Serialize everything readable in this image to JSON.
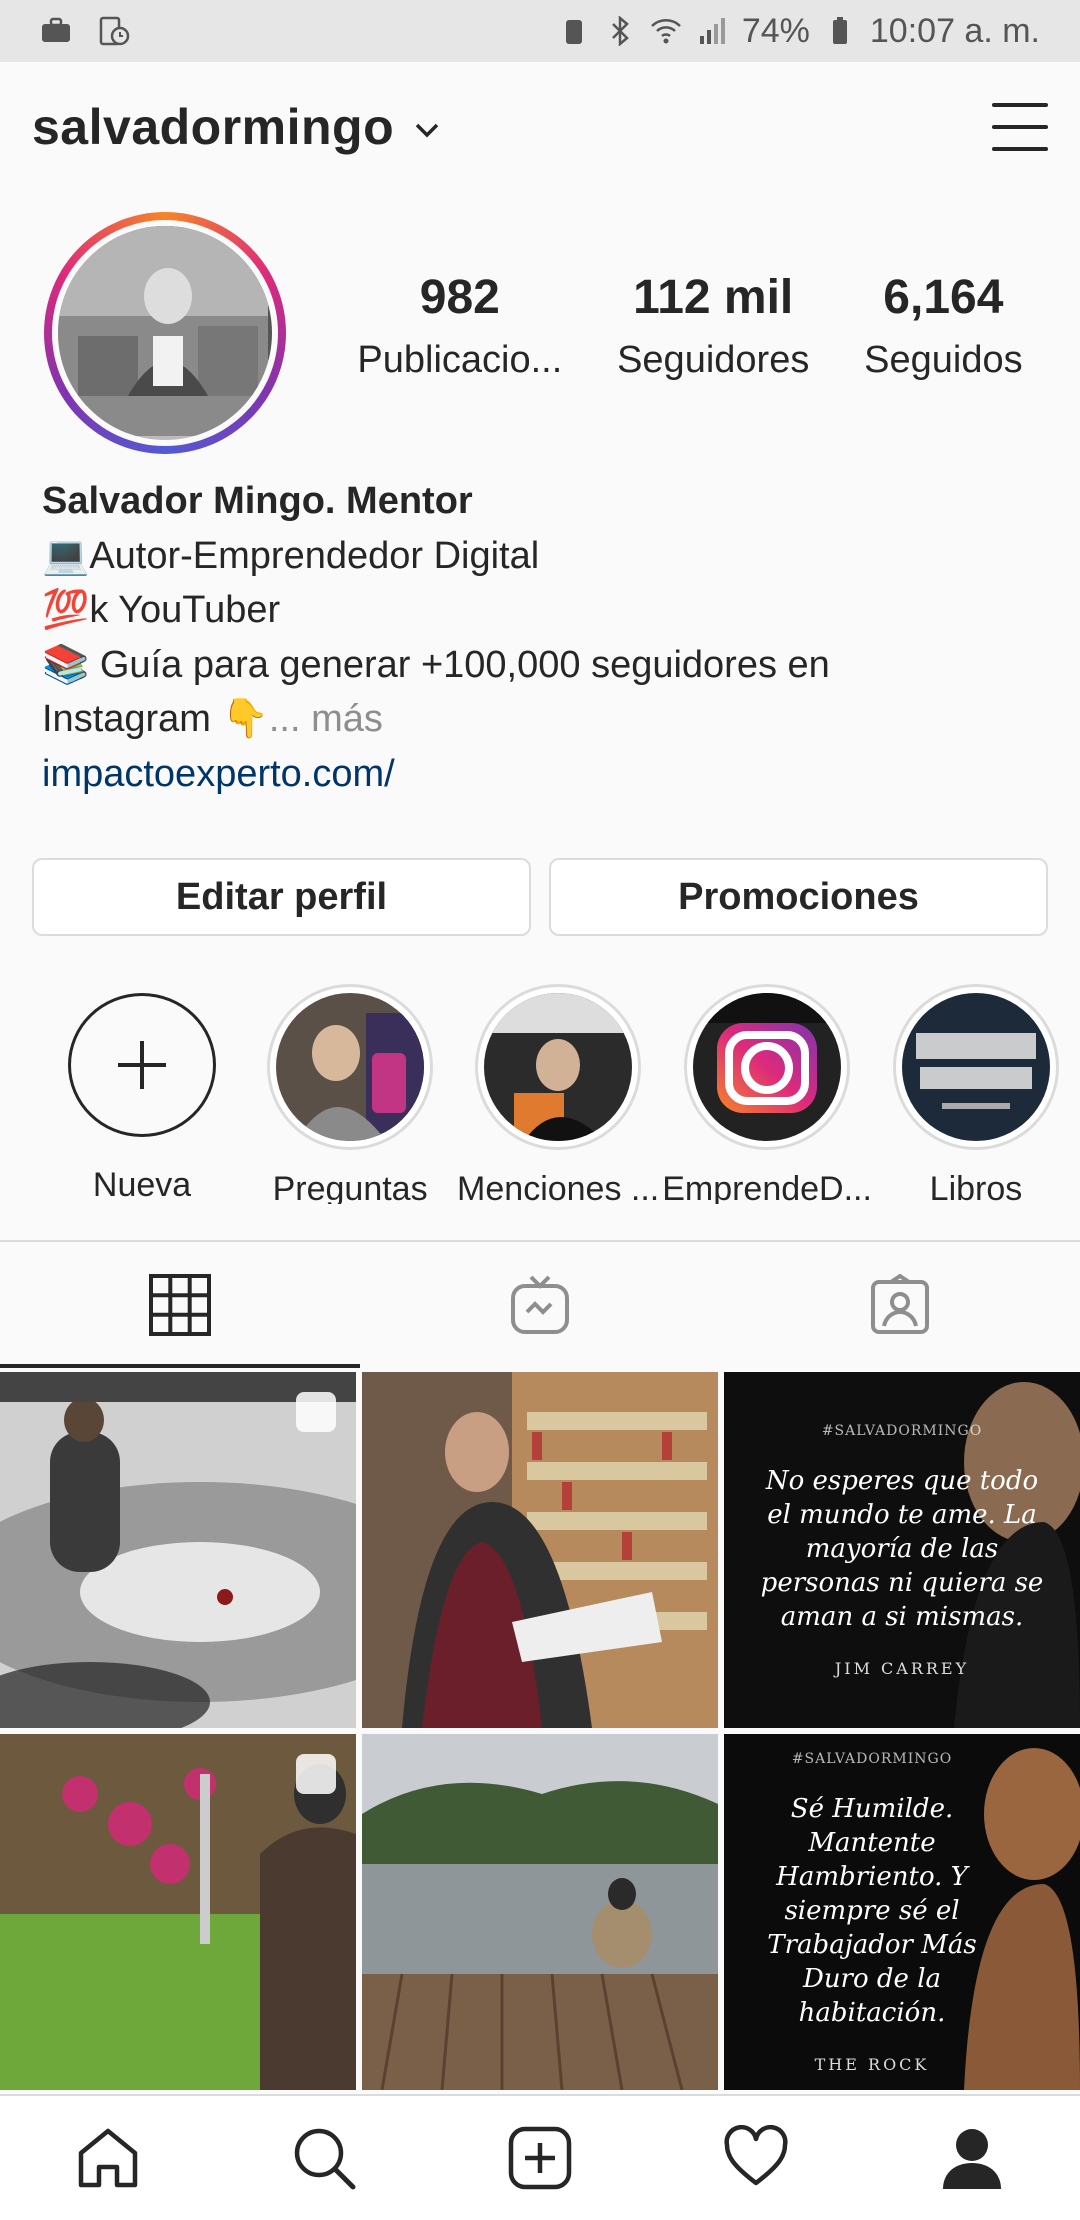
{
  "status_bar": {
    "battery": "74%",
    "time": "10:07 a. m."
  },
  "header": {
    "username": "salvadormingo"
  },
  "stats": [
    {
      "value": "982",
      "label": "Publicacio..."
    },
    {
      "value": "112 mil",
      "label": "Seguidores"
    },
    {
      "value": "6,164",
      "label": "Seguidos"
    }
  ],
  "bio": {
    "name": "Salvador Mingo. Mentor",
    "line1": "💻Autor-Emprendedor Digital",
    "line2": "💯k YouTuber",
    "line3": "📚 Guía para generar +100,000 seguidores en",
    "line4": "Instagram 👇",
    "more": "... más",
    "link": "impactoexperto.com/"
  },
  "buttons": {
    "edit_profile": "Editar perfil",
    "promotions": "Promociones"
  },
  "highlights": [
    {
      "label": "Nueva"
    },
    {
      "label": "Preguntas"
    },
    {
      "label": "Menciones ..."
    },
    {
      "label": "EmprendeD..."
    },
    {
      "label": "Libros"
    }
  ],
  "posts": {
    "quote1": {
      "tag": "#SALVADORMINGO",
      "text": "No esperes que todo el mundo te ame. La mayoría de las personas ni quiera se aman a si mismas.",
      "author": "JIM CARREY"
    },
    "quote2": {
      "tag": "#SALVADORMINGO",
      "text": "Sé Humilde. Mantente Hambriento. Y siempre sé el Trabajador Más Duro de la habitación.",
      "author": "THE ROCK"
    }
  },
  "colors": {
    "link": "#003569",
    "text": "#262626",
    "muted": "#8e8e8e",
    "border": "#dbdbdb"
  }
}
